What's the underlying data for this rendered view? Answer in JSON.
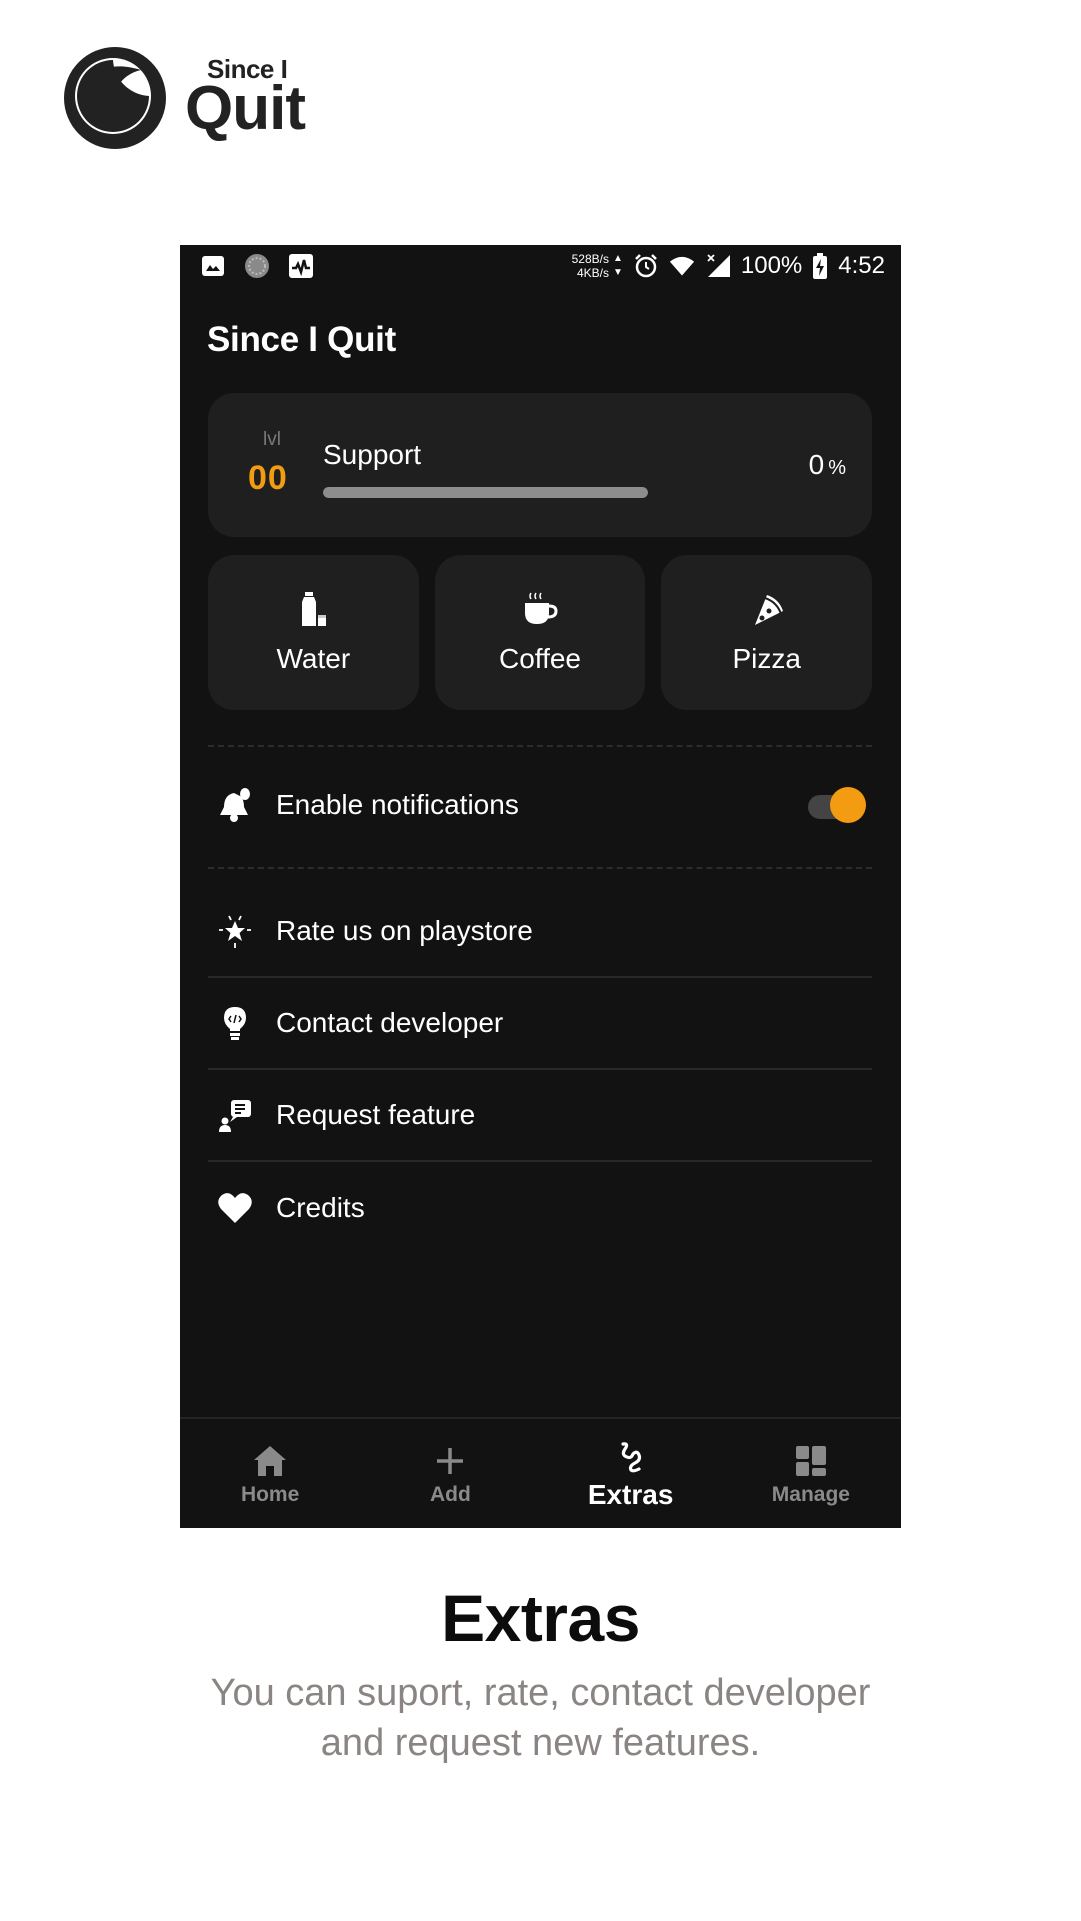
{
  "brand": {
    "small_text": "Since I",
    "big_text": "Quit",
    "color": "#222222"
  },
  "status_bar": {
    "net_up": "528B/s",
    "net_down": "4KB/s",
    "battery": "100%",
    "time": "4:52",
    "left_icons": [
      "gallery-icon",
      "sync-icon",
      "activity-icon"
    ],
    "right_icons": [
      "alarm-icon",
      "wifi-icon",
      "signal-icon",
      "battery-charging-icon"
    ]
  },
  "app": {
    "title": "Since I Quit",
    "accent": "#f39c12",
    "background": "#121212",
    "card_background": "#1f1f1f"
  },
  "support": {
    "lvl_label": "lvl",
    "lvl_value": "00",
    "label": "Support",
    "percent_value": "0",
    "percent_sign": "%",
    "progress": 0
  },
  "treats": [
    {
      "label": "Water",
      "icon": "water-bottle-icon"
    },
    {
      "label": "Coffee",
      "icon": "coffee-cup-icon"
    },
    {
      "label": "Pizza",
      "icon": "pizza-icon"
    }
  ],
  "notifications": {
    "label": "Enable notifications",
    "enabled": true
  },
  "menu": [
    {
      "label": "Rate us on playstore",
      "icon": "star-sparkle-icon"
    },
    {
      "label": "Contact developer",
      "icon": "lightbulb-code-icon"
    },
    {
      "label": "Request feature",
      "icon": "feature-request-icon"
    },
    {
      "label": "Credits",
      "icon": "heart-icon"
    }
  ],
  "bottom_nav": [
    {
      "label": "Home",
      "icon": "home-icon",
      "active": false
    },
    {
      "label": "Add",
      "icon": "plus-icon",
      "active": false
    },
    {
      "label": "Extras",
      "icon": "squiggle-icon",
      "active": true
    },
    {
      "label": "Manage",
      "icon": "dashboard-icon",
      "active": false
    }
  ],
  "caption": {
    "title": "Extras",
    "description_line1": "You can suport, rate, contact developer",
    "description_line2": "and request new features."
  }
}
